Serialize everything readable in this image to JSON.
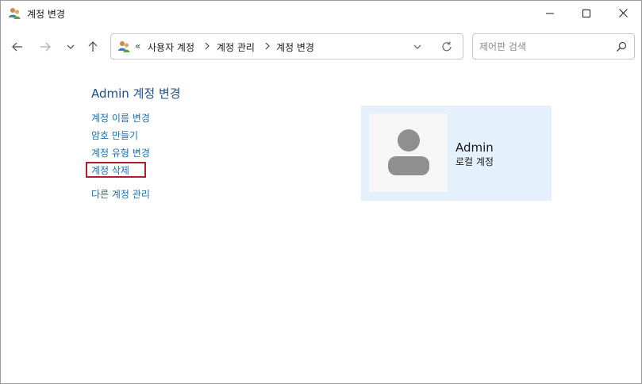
{
  "window": {
    "title": "계정 변경",
    "minimize_label": "최소화",
    "maximize_label": "최대화",
    "close_label": "닫기"
  },
  "address": {
    "overflow": "«",
    "breadcrumbs": [
      "사용자 계정",
      "계정 관리",
      "계정 변경"
    ]
  },
  "search": {
    "placeholder": "제어판 검색",
    "value": ""
  },
  "page": {
    "title": "Admin 계정 변경",
    "links": [
      "계정 이름 변경",
      "암호 만들기",
      "계정 유형 변경",
      "계정 삭제",
      "다른 계정 관리"
    ]
  },
  "account": {
    "name": "Admin",
    "type": "로컬 계정"
  },
  "colors": {
    "link": "#1a6fb5",
    "title": "#1e4e8c",
    "card_background": "#e4f1fc",
    "highlight": "#b01e2a"
  }
}
